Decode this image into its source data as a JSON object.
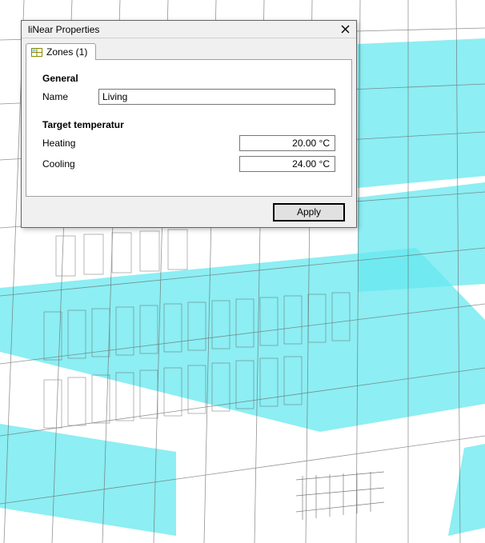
{
  "dialog": {
    "title": "liNear Properties",
    "tab_label": "Zones (1)",
    "general_heading": "General",
    "name_label": "Name",
    "name_value": "Living",
    "target_heading": "Target temperatur",
    "heating_label": "Heating",
    "heating_value": "20.00 °C",
    "cooling_label": "Cooling",
    "cooling_value": "24.00 °C",
    "apply_label": "Apply"
  }
}
